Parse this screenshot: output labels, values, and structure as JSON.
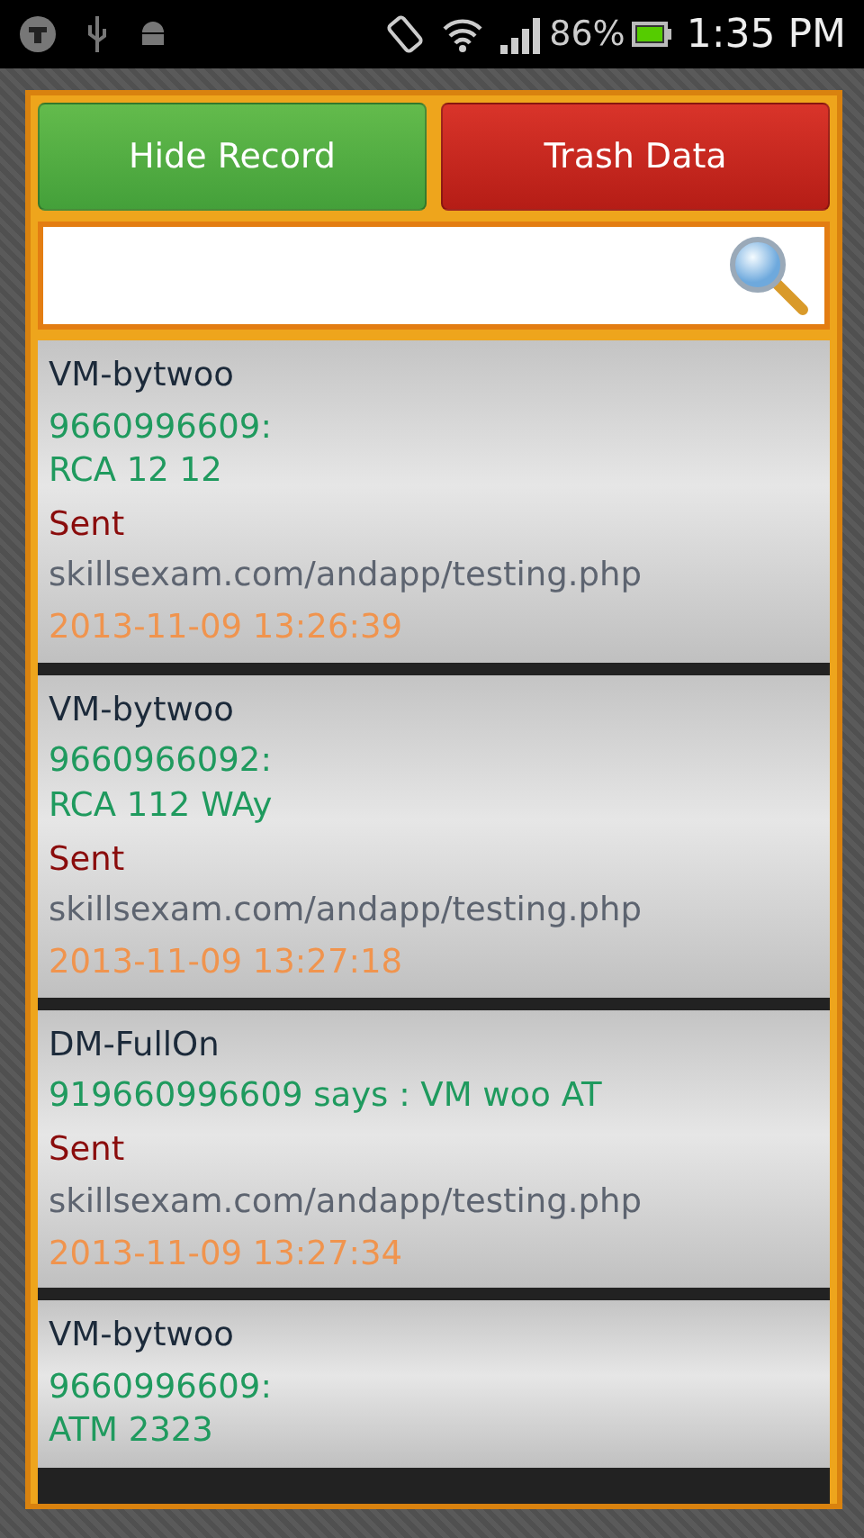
{
  "status_bar": {
    "battery": "86%",
    "time": "1:35 PM"
  },
  "buttons": [
    {
      "label": "Hide Record",
      "kind": "hide"
    },
    {
      "label": "Trash Data",
      "kind": "trash"
    }
  ],
  "records": [
    {
      "sender": "VM-bytwoo",
      "message": "9660996609:\nRCA 12 12",
      "status": "Sent",
      "url": "skillsexam.com/andapp/testing.php",
      "timestamp": "2013-11-09 13:26:39"
    },
    {
      "sender": "VM-bytwoo",
      "message": "9660966092:\nRCA 112 WAy",
      "status": "Sent",
      "url": "skillsexam.com/andapp/testing.php",
      "timestamp": "2013-11-09 13:27:18"
    },
    {
      "sender": "DM-FullOn",
      "message": "919660996609 says :  VM woo AT",
      "status": "Sent",
      "url": "skillsexam.com/andapp/testing.php",
      "timestamp": "2013-11-09 13:27:34"
    },
    {
      "sender": "VM-bytwoo",
      "message": "9660996609:\nATM 2323"
    }
  ]
}
